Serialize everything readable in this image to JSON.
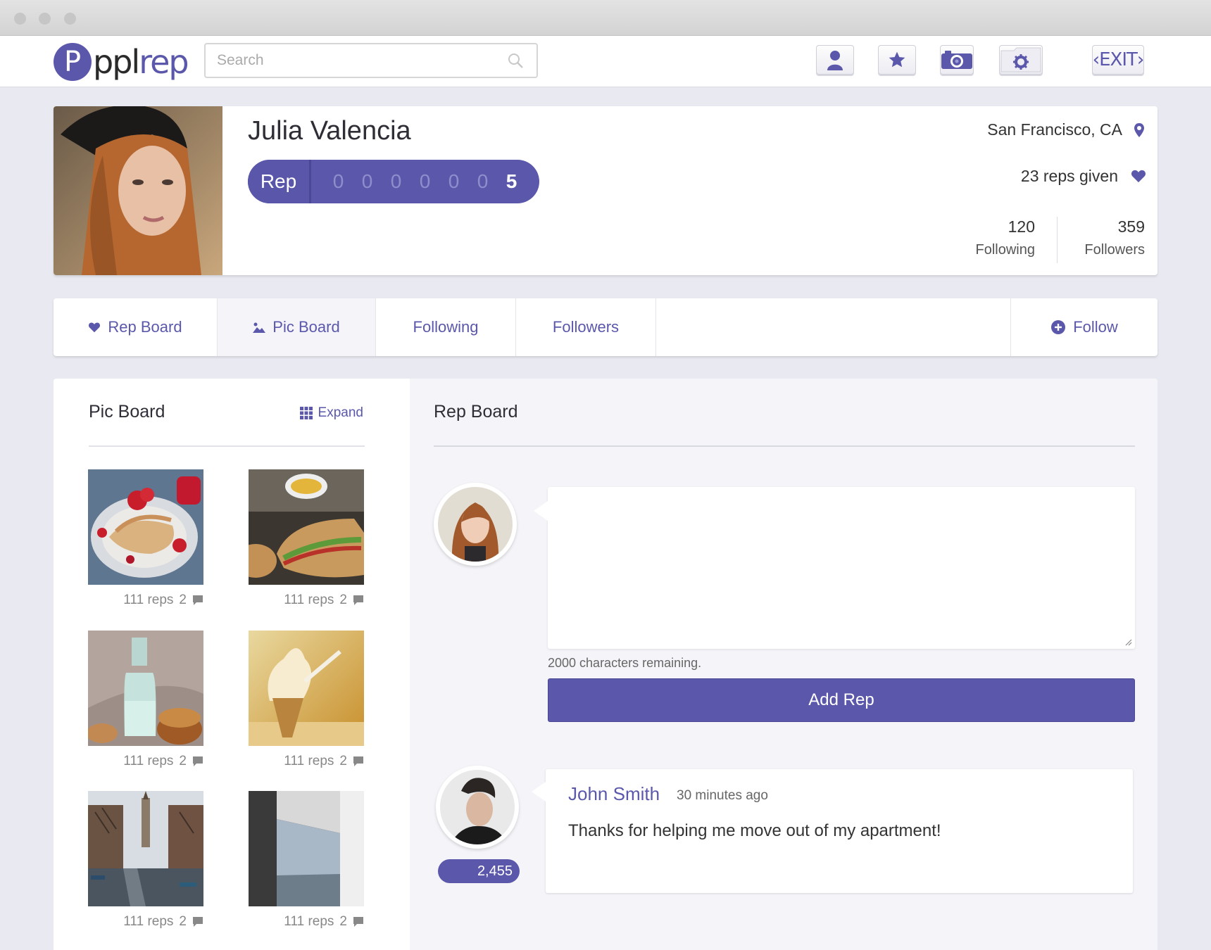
{
  "brand": {
    "logo_text_a": "ppl",
    "logo_text_b": "rep",
    "logo_mark": "P",
    "accent_color": "#5b58ab"
  },
  "search": {
    "placeholder": "Search",
    "value": ""
  },
  "nav": {
    "icons": [
      "profile-icon",
      "star-icon",
      "camera-icon",
      "settings-folder-icon"
    ],
    "exit_label": "‹EXIT›"
  },
  "profile": {
    "name": "Julia Valencia",
    "rep_label": "Rep",
    "rep_digits": [
      "0",
      "0",
      "0",
      "0",
      "0",
      "0",
      "5"
    ],
    "location": "San Francisco, CA",
    "reps_given": "23 reps given",
    "following_count": "120",
    "following_label": "Following",
    "followers_count": "359",
    "followers_label": "Followers"
  },
  "tabs": {
    "rep_board": "Rep Board",
    "pic_board": "Pic Board",
    "following": "Following",
    "followers": "Followers",
    "follow": "Follow"
  },
  "pic_board": {
    "title": "Pic Board",
    "expand_label": "Expand",
    "pics": [
      {
        "subject": "crepes-with-berries",
        "reps": "111 reps",
        "comments": "2"
      },
      {
        "subject": "sandwich",
        "reps": "111 reps",
        "comments": "2"
      },
      {
        "subject": "milk-bottle-muffins",
        "reps": "111 reps",
        "comments": "2"
      },
      {
        "subject": "ice-cream-cone",
        "reps": "111 reps",
        "comments": "2"
      },
      {
        "subject": "canal-street",
        "reps": "111 reps",
        "comments": "2"
      },
      {
        "subject": "building-corner",
        "reps": "111 reps",
        "comments": "2"
      }
    ]
  },
  "rep_board": {
    "title": "Rep Board",
    "compose_value": "",
    "chars_remaining": "2000 characters remaining.",
    "add_button": "Add Rep",
    "post": {
      "author": "John Smith",
      "time": "30 minutes ago",
      "text": "Thanks for helping me move out of my apartment!",
      "author_rep": "2,455"
    }
  }
}
